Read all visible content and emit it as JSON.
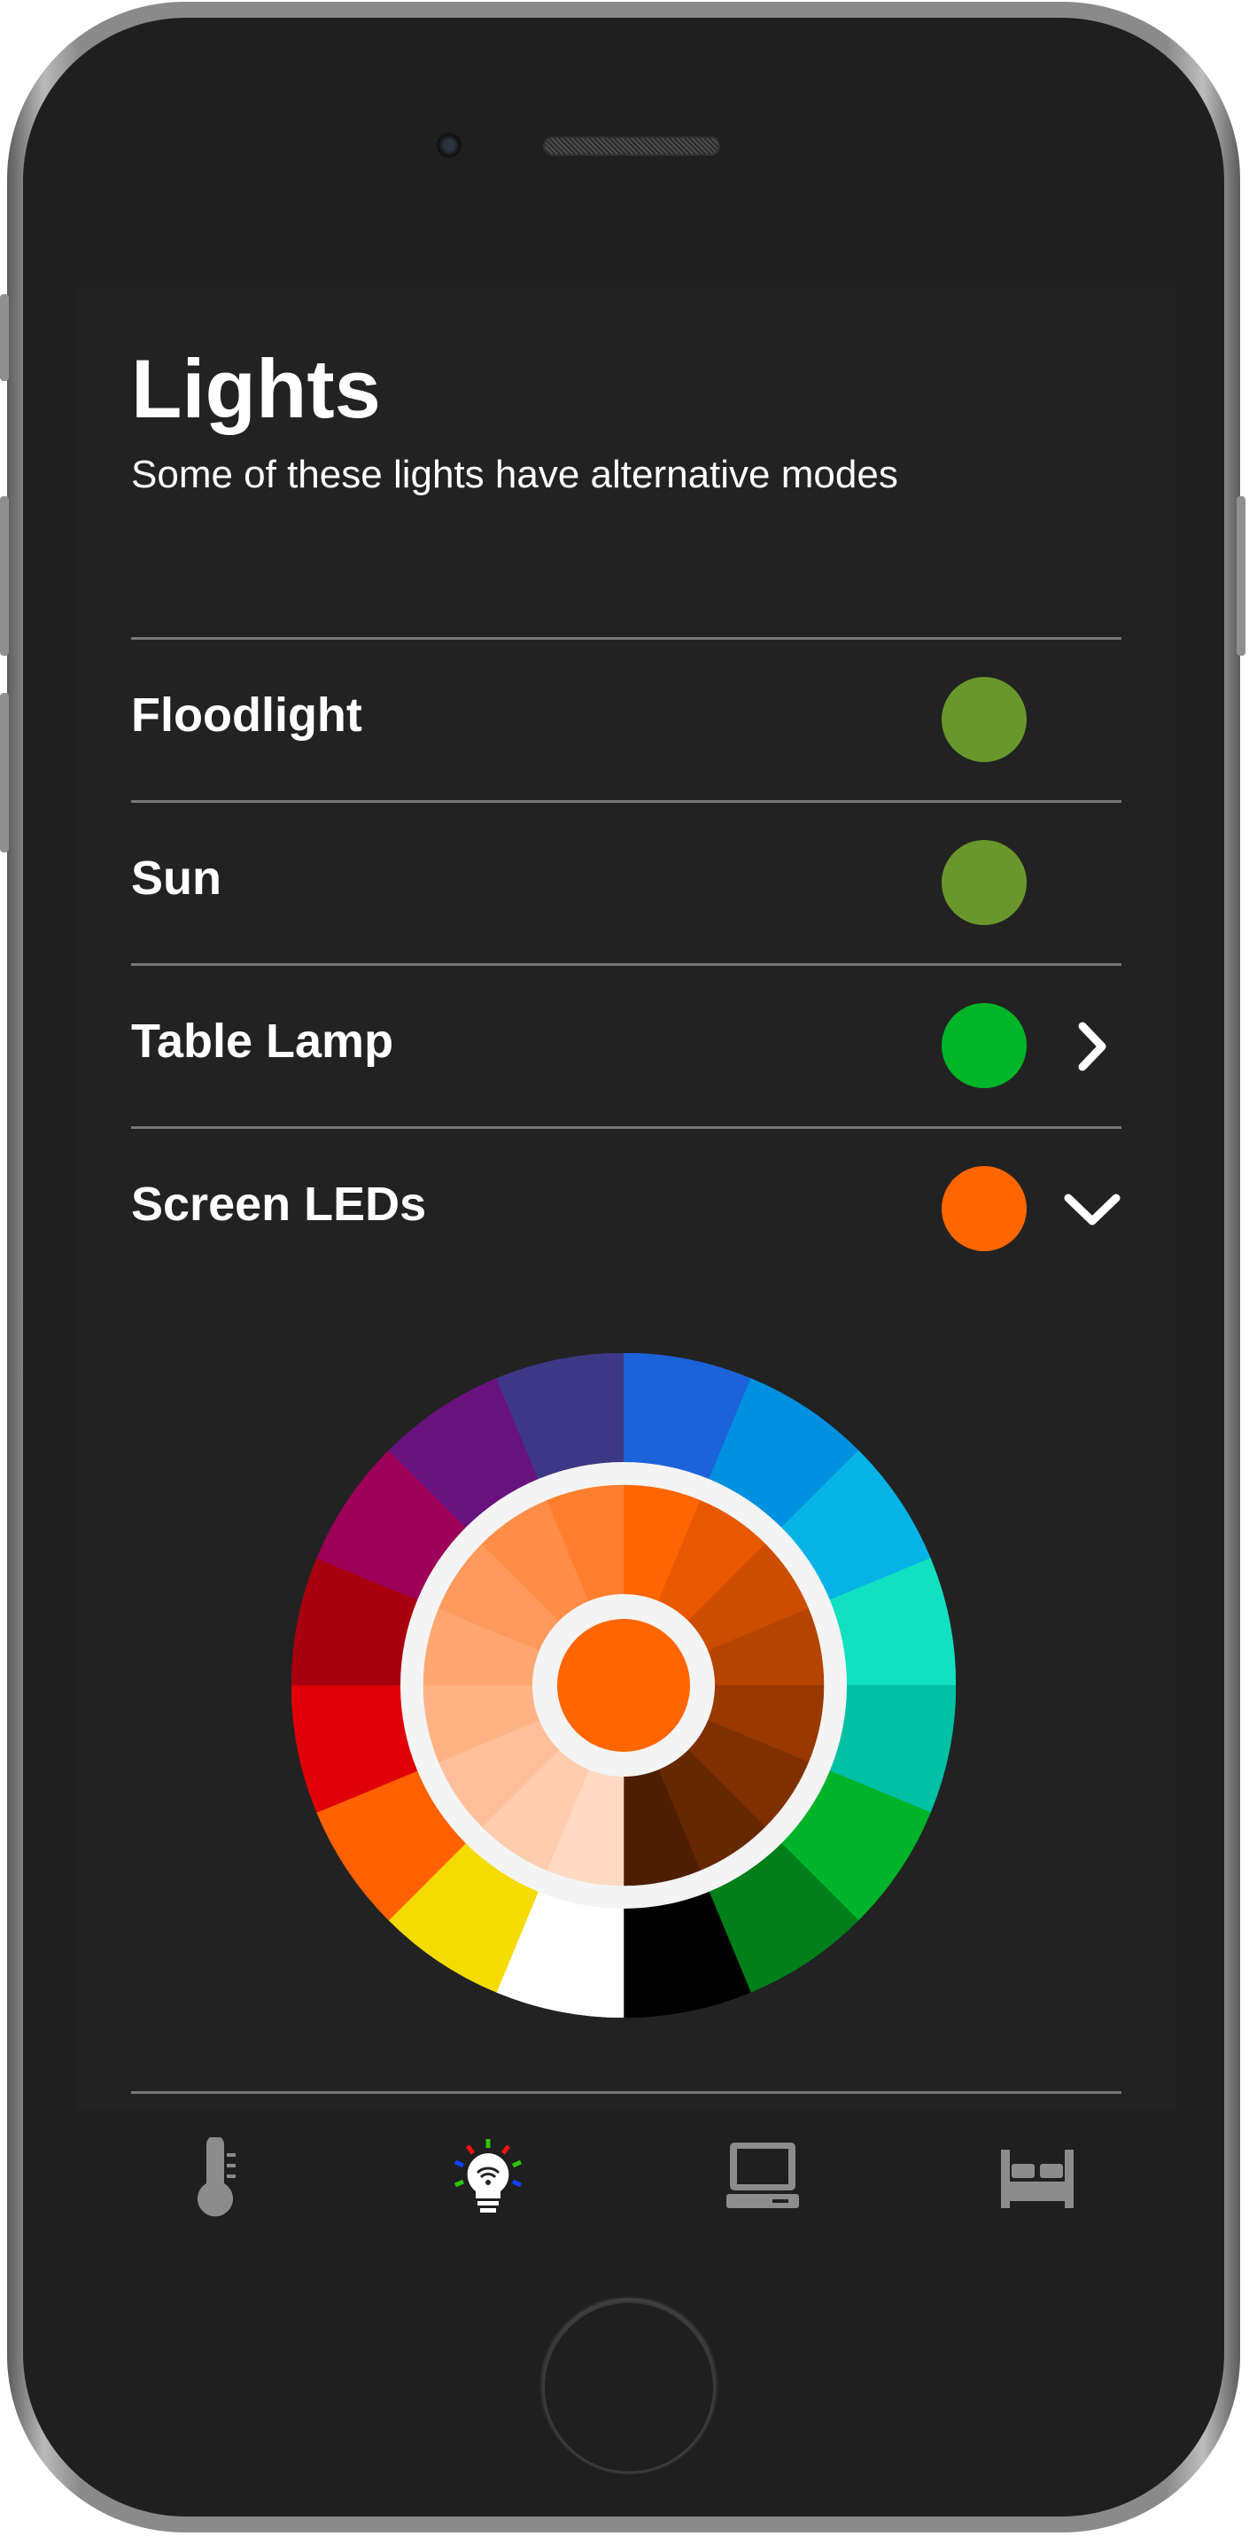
{
  "header": {
    "title": "Lights",
    "subtitle": "Some of these lights have alternative modes"
  },
  "lights": [
    {
      "name": "Floodlight",
      "color": "#6a972b",
      "indicator": "none"
    },
    {
      "name": "Sun",
      "color": "#6a972b",
      "indicator": "none"
    },
    {
      "name": "Table Lamp",
      "color": "#00b528",
      "indicator": "chevron-right-icon"
    },
    {
      "name": "Screen LEDs",
      "color": "#ff6600",
      "indicator": "chevron-down-icon",
      "expanded": true
    }
  ],
  "color_picker": {
    "selected_color": "#ff6600",
    "hue_ring": [
      "#1c62d8",
      "#0090e0",
      "#05b3e6",
      "#12e0c2",
      "#00c0a6",
      "#00b42a",
      "#007f1b",
      "#000000",
      "#ffffff",
      "#f5dc00",
      "#ff6000",
      "#e00008",
      "#a90010",
      "#9c0058",
      "#68127e",
      "#3d3886"
    ],
    "shade_ring": [
      "#ff6500",
      "#e85800",
      "#cc4d00",
      "#b54400",
      "#993900",
      "#803000",
      "#662800",
      "#4d1f00",
      "#ffd9c2",
      "#ffccad",
      "#ffbf9a",
      "#ffb385",
      "#ffa671",
      "#ff995c",
      "#ff8c47",
      "#ff7e2e"
    ]
  },
  "tabbar": {
    "items": [
      {
        "icon": "thermometer-icon",
        "active": false
      },
      {
        "icon": "lightbulb-icon",
        "active": true
      },
      {
        "icon": "computer-icon",
        "active": false
      },
      {
        "icon": "bed-icon",
        "active": false
      }
    ],
    "inactive_color": "#8c8c8c"
  }
}
